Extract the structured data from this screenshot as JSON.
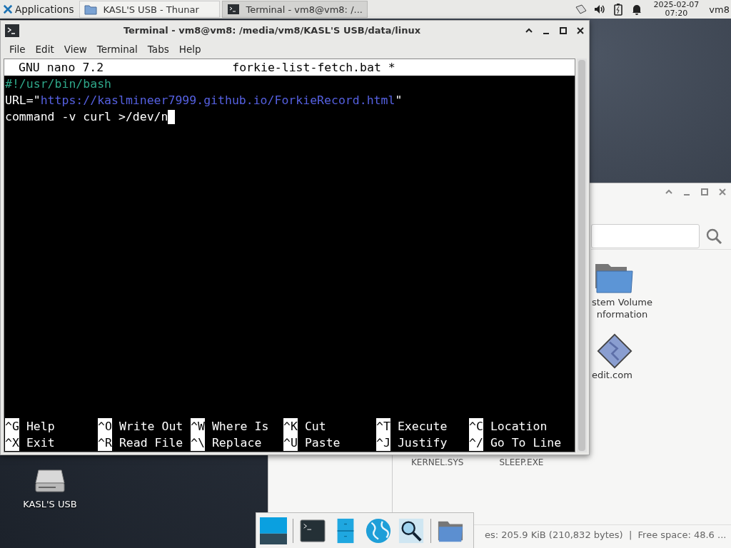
{
  "panel": {
    "applications": "Applications",
    "tasks": [
      {
        "label": "KASL'S USB - Thunar",
        "kind": "folder",
        "selected": false
      },
      {
        "label": "Terminal - vm8@vm8: /...",
        "kind": "terminal",
        "selected": true
      }
    ],
    "date": "2025-02-07",
    "time": "07:20",
    "user": "vm8"
  },
  "terminal": {
    "title": "Terminal - vm8@vm8: /media/vm8/KASL'S USB/data/linux",
    "menu": [
      "File",
      "Edit",
      "View",
      "Terminal",
      "Tabs",
      "Help"
    ],
    "nano": {
      "version": "GNU nano 7.2",
      "filename": "forkie-list-fetch.bat *",
      "lines": [
        {
          "segments": [
            {
              "text": "#!/usr/bin/bash",
              "kind": "comment"
            }
          ],
          "cursor": false
        },
        {
          "segments": [
            {
              "text": "URL=\"",
              "kind": "plain"
            },
            {
              "text": "https://kaslmineer7999.github.io/ForkieRecord.html",
              "kind": "string"
            },
            {
              "text": "\"",
              "kind": "plain"
            }
          ],
          "cursor": false
        },
        {
          "segments": [
            {
              "text": "command -v curl >/dev/n",
              "kind": "plain"
            }
          ],
          "cursor": true
        }
      ],
      "shortcuts": [
        [
          {
            "key": "^G",
            "label": "Help"
          },
          {
            "key": "^O",
            "label": "Write Out"
          },
          {
            "key": "^W",
            "label": "Where Is"
          },
          {
            "key": "^K",
            "label": "Cut"
          },
          {
            "key": "^T",
            "label": "Execute"
          },
          {
            "key": "^C",
            "label": "Location"
          }
        ],
        [
          {
            "key": "^X",
            "label": "Exit"
          },
          {
            "key": "^R",
            "label": "Read File"
          },
          {
            "key": "^\\",
            "label": "Replace"
          },
          {
            "key": "^U",
            "label": "Paste"
          },
          {
            "key": "^J",
            "label": "Justify"
          },
          {
            "key": "^/",
            "label": "Go To Line"
          }
        ]
      ]
    }
  },
  "file_manager": {
    "files": [
      {
        "label": "stem Volume\nnformation",
        "kind": "folder"
      },
      {
        "label": "edit.com",
        "kind": "program"
      }
    ],
    "lower_files": [
      "KERNEL.SYS",
      "SLEEP.EXE"
    ],
    "status": "es: 205.9 KiB (210,832 bytes)  |  Free space: 48.6 ..."
  },
  "desktop_icons": [
    {
      "label": "KASL'S USB"
    }
  ]
}
